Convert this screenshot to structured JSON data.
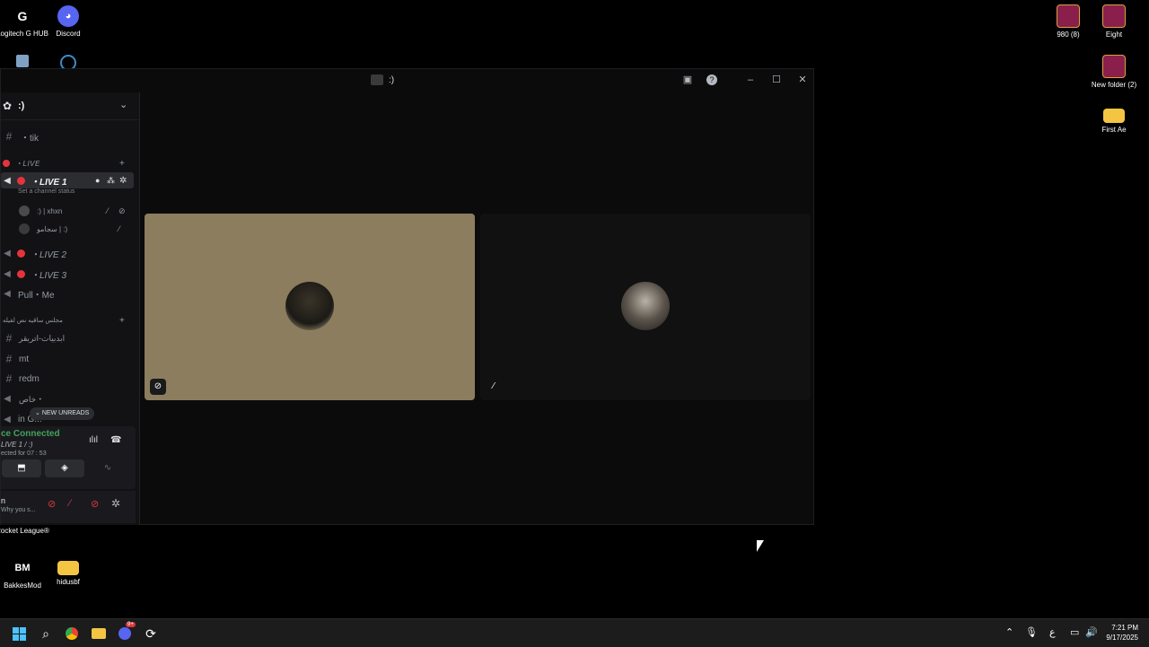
{
  "desktop": {
    "icons_left": [
      {
        "label": "Logitech G HUB",
        "icon": "logitech-icon"
      },
      {
        "label": "Discord",
        "icon": "discord-icon"
      },
      {
        "label": "",
        "icon": "recycle-bin-icon"
      },
      {
        "label": "",
        "icon": "loading-app-icon"
      },
      {
        "label": "Rocket League®",
        "icon": "rocket-league-icon"
      },
      {
        "label": "BakkesMod",
        "icon": "bakkesmod-icon"
      },
      {
        "label": "hidusbf",
        "icon": "folder-icon"
      }
    ],
    "icons_right": [
      {
        "label": "980 (8)",
        "icon": "winrar-icon"
      },
      {
        "label": "Eight",
        "icon": "winrar-icon"
      },
      {
        "label": "New folder (2)",
        "icon": "winrar-icon"
      },
      {
        "label": "First Ae",
        "icon": "folder-icon"
      }
    ]
  },
  "window": {
    "title": ":)",
    "controls": {
      "minimize": "–",
      "maximize": "☐",
      "close": "✕"
    }
  },
  "sidebar": {
    "server_name": ":)",
    "channels": [
      {
        "type": "text",
        "label": "・tik"
      },
      {
        "type": "category",
        "label": "・LIVE"
      },
      {
        "type": "voice-live",
        "label": "・LIVE 1",
        "status": "Set a channel status"
      },
      {
        "type": "member",
        "label": ":) | xhxn"
      },
      {
        "type": "member",
        "label": "سجامو | :)"
      },
      {
        "type": "voice-live",
        "label": "・LIVE 2"
      },
      {
        "type": "voice-live",
        "label": "・LIVE 3"
      },
      {
        "type": "voice",
        "label": "Pull・Me"
      },
      {
        "type": "category",
        "label": "مجلس ساقيه نص لفيله"
      },
      {
        "type": "text",
        "label": "ابدبيات-اتربقر"
      },
      {
        "type": "text",
        "label": "mt"
      },
      {
        "type": "text",
        "label": "redm"
      },
      {
        "type": "voice",
        "label": "خاص・"
      },
      {
        "type": "voice",
        "label": "in G..."
      }
    ],
    "new_unreads": "NEW UNREADS",
    "voice_panel": {
      "status": "ce Connected",
      "channel": "LIVE 1 / :)",
      "timer": "ected for 07 : 53"
    },
    "user_panel": {
      "name": "n",
      "status": "Why you s..."
    }
  },
  "taskbar": {
    "time": "7:21 PM",
    "date": "9/17/2025",
    "lang": "ع",
    "discord_badge": "9+"
  }
}
